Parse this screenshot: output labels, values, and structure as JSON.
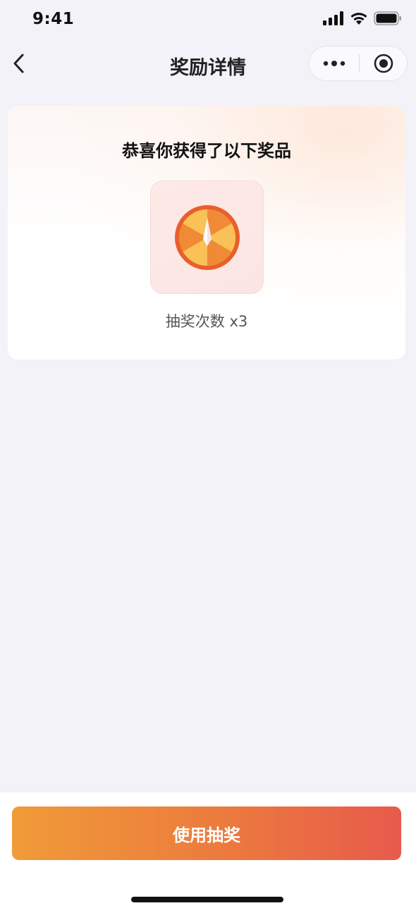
{
  "status_bar": {
    "time": "9:41"
  },
  "nav": {
    "title": "奖励详情"
  },
  "card": {
    "headline": "恭喜你获得了以下奖品",
    "prize": {
      "icon": "spin-wheel-icon",
      "label": "抽奖次数 x3"
    }
  },
  "actions": {
    "use_label": "使用抽奖"
  },
  "colors": {
    "accent_start": "#f09b38",
    "accent_end": "#e75a4c",
    "background": "#f3f2f8"
  }
}
